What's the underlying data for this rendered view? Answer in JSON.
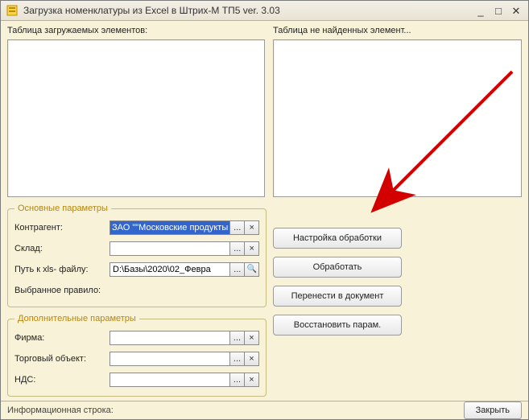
{
  "window": {
    "title": "Загрузка номенклатуры из Excel в Штрих-М ТП5 ver. 3.03"
  },
  "panes": {
    "left_label": "Таблица загружаемых элементов:",
    "right_label": "Таблица не найденных элемент..."
  },
  "groups": {
    "main_title": "Основные параметры",
    "extra_title": "Дополнительные параметры"
  },
  "main": {
    "contragent_label": "Контрагент:",
    "contragent_value": "ЗАО \"\"Московские продукты",
    "sklad_label": "Склад:",
    "sklad_value": "",
    "path_label": "Путь к xls- файлу:",
    "path_value": "D:\\Базы\\2020\\02_Февра",
    "rule_label": "Выбранное правило:",
    "rule_value": ""
  },
  "extra": {
    "firma_label": "Фирма:",
    "firma_value": "",
    "torg_label": "Торговый объект:",
    "torg_value": "",
    "nds_label": "НДС:",
    "nds_value": ""
  },
  "buttons": {
    "settings": "Настройка обработки",
    "process": "Обработать",
    "transfer": "Перенести в документ",
    "restore": "Восстановить парам."
  },
  "status": {
    "text": "Информационная строка:"
  },
  "footer": {
    "close": "Закрыть"
  },
  "glyphs": {
    "ellipsis": "...",
    "clear": "×",
    "lookup": "🔍",
    "minimize": "_",
    "maximize": "□",
    "close": "✕"
  }
}
